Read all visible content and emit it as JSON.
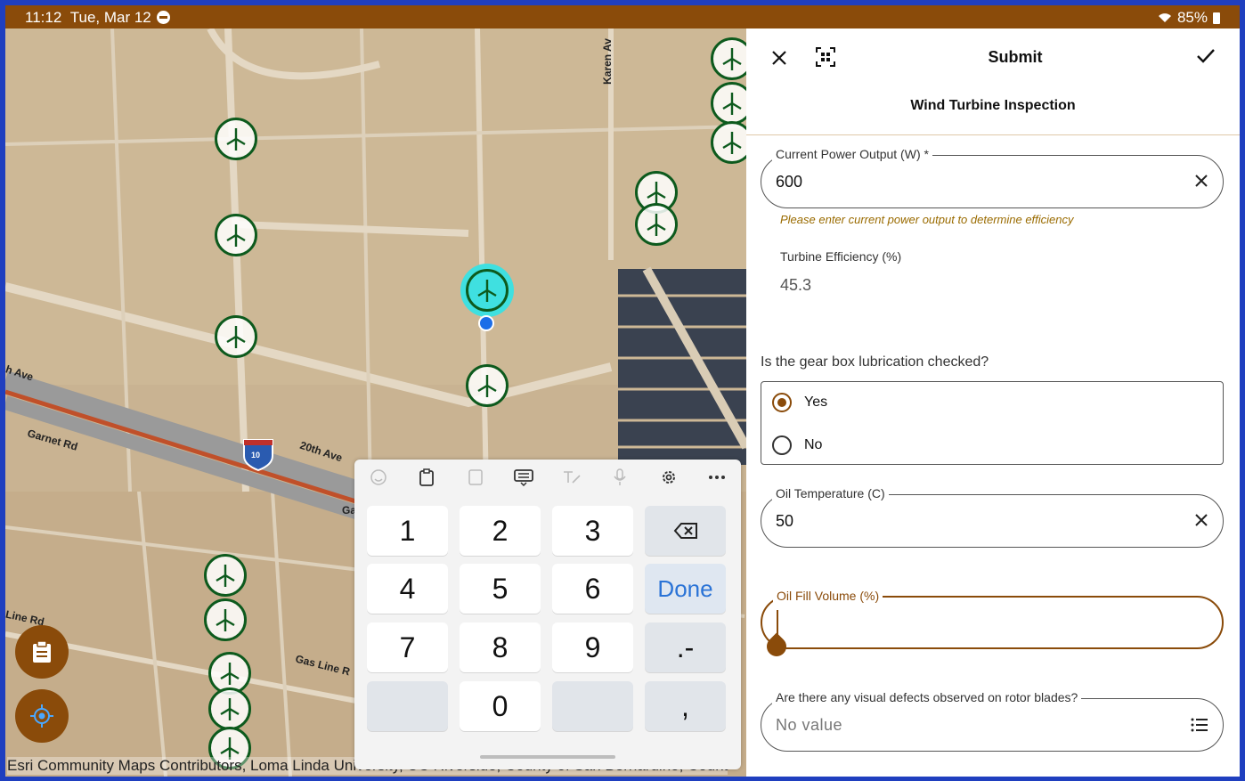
{
  "status_bar": {
    "time": "11:12",
    "date": "Tue, Mar 12",
    "battery": "85%"
  },
  "map": {
    "road_labels": [
      "h Ave",
      "Garnet Rd",
      "20th Ave",
      "Ga",
      "Line Rd",
      "Gas Line R",
      "Karen Av"
    ],
    "highway_shield": "10",
    "attribution": "Esri Community Maps Contributors, Loma Linda University, UC Riverside, County of San Bernardino, Count"
  },
  "keypad": {
    "keys": [
      "1",
      "2",
      "3",
      "4",
      "5",
      "6",
      "7",
      "8",
      "9",
      "0"
    ],
    "done_label": "Done",
    "dot_dash_label": ".-",
    "comma_label": ","
  },
  "form": {
    "title": "Submit",
    "subtitle": "Wind Turbine Inspection",
    "power_output": {
      "label": "Current Power Output (W) *",
      "value": "600",
      "hint": "Please enter current power output to determine efficiency"
    },
    "efficiency": {
      "label": "Turbine Efficiency (%)",
      "value": "45.3"
    },
    "gearbox": {
      "question": "Is the gear box lubrication checked?",
      "option_yes": "Yes",
      "option_no": "No"
    },
    "oil_temperature": {
      "label": "Oil Temperature (C)",
      "value": "50"
    },
    "oil_fill": {
      "label": "Oil Fill Volume (%)"
    },
    "defects": {
      "label": "Are there any visual defects observed on rotor blades?",
      "placeholder": "No value"
    }
  },
  "colors": {
    "accent": "#8a4b0a",
    "turbine": "#0d5a1d",
    "selected": "#3fe0e0",
    "done_text": "#2a73d6"
  }
}
